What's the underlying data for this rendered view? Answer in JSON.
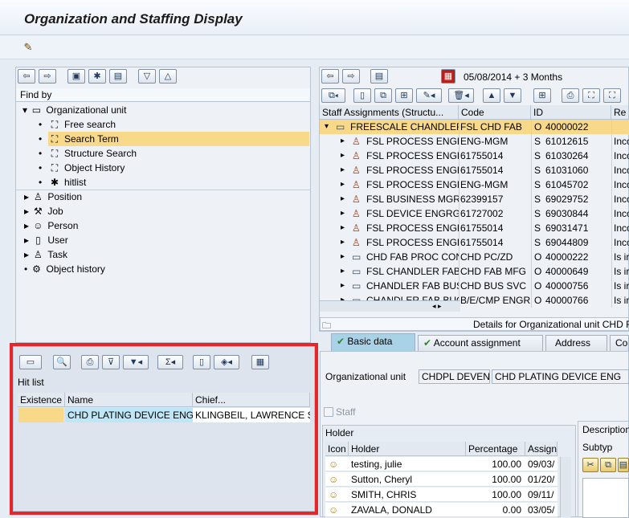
{
  "title": "Organization and Staffing Display",
  "nav": {
    "date": "05/08/2014",
    "period": "+ 3 Months"
  },
  "findby": {
    "header": "Find by",
    "org_unit": "Organizational unit",
    "org_children": [
      "Free search",
      "Search Term",
      "Structure Search",
      "Object History",
      "hitlist"
    ],
    "others": [
      "Position",
      "Job",
      "Person",
      "User",
      "Task",
      "Object history"
    ]
  },
  "hitlist": {
    "title": "Hit list",
    "columns": [
      "Existence",
      "Name",
      "Chief..."
    ],
    "row": {
      "name": "CHD PLATING DEVICE ENG",
      "chief": "KLINGBEIL, LAWRENCE S"
    }
  },
  "staff": {
    "columns": [
      "Staff Assignments (Structu...",
      "Code",
      "ID",
      "Re"
    ],
    "rows": [
      {
        "name": "FREESCALE CHANDLER F",
        "code": "FSL CHD FAB",
        "type": "O",
        "id": "40000022",
        "re": ""
      },
      {
        "name": "FSL PROCESS ENGRG",
        "code": "ENG-MGM",
        "type": "S",
        "id": "61012615",
        "re": "Inco"
      },
      {
        "name": "FSL PROCESS ENGRG",
        "code": "61755014",
        "type": "S",
        "id": "61030264",
        "re": "Inco"
      },
      {
        "name": "FSL PROCESS ENGRG",
        "code": "61755014",
        "type": "S",
        "id": "61031060",
        "re": "Inco"
      },
      {
        "name": "FSL PROCESS ENGRG",
        "code": "ENG-MGM",
        "type": "S",
        "id": "61045702",
        "re": "Inco"
      },
      {
        "name": "FSL BUSINESS MGR I",
        "code": "62399157",
        "type": "S",
        "id": "69029752",
        "re": "Inco"
      },
      {
        "name": "FSL DEVICE ENGRG I",
        "code": "61727002",
        "type": "S",
        "id": "69030844",
        "re": "Inco"
      },
      {
        "name": "FSL PROCESS ENGRG",
        "code": "61755014",
        "type": "S",
        "id": "69031471",
        "re": "Inco"
      },
      {
        "name": "FSL PROCESS ENGRG",
        "code": "61755014",
        "type": "S",
        "id": "69044809",
        "re": "Inco"
      },
      {
        "name": "CHD FAB PROC CONT",
        "code": "CHD PC/ZD",
        "type": "O",
        "id": "40000222",
        "re": "Is ir"
      },
      {
        "name": "FSL CHANDLER FAB",
        "code": "CHD FAB MFG",
        "type": "O",
        "id": "40000649",
        "re": "Is ir"
      },
      {
        "name": "CHANDLER FAB BUSI",
        "code": "CHD BUS SVC",
        "type": "O",
        "id": "40000756",
        "re": "Is ir"
      },
      {
        "name": "CHANDLER FAB BUO",
        "code": "B/E/CMP ENGR",
        "type": "O",
        "id": "40000766",
        "re": "Is ir"
      }
    ]
  },
  "details": {
    "label": "Details for Organizational unit CHD F",
    "tabs": [
      "Basic data",
      "Account assignment",
      "Address",
      "Cost"
    ],
    "org_unit_label": "Organizational unit",
    "org_short": "CHDPL DEVEN...",
    "org_long": "CHD PLATING DEVICE ENG",
    "staff_label": "Staff",
    "holder_section": "Holder",
    "holder_columns": [
      "Icon",
      "Holder",
      "Percentage",
      "Assign"
    ],
    "holders": [
      {
        "name": "testing, julie",
        "pct": "100.00",
        "assign": "09/03/"
      },
      {
        "name": "Sutton, Cheryl",
        "pct": "100.00",
        "assign": "01/20/"
      },
      {
        "name": "SMITH, CHRIS",
        "pct": "100.00",
        "assign": "09/11/"
      },
      {
        "name": "ZAVALA, DONALD",
        "pct": "0.00",
        "assign": "03/05/"
      }
    ],
    "description": "Description",
    "subtype": "Subtyp"
  },
  "colors": {
    "selection": "#f8d98a",
    "hit_name_bg": "#bfe6f6",
    "frame": "#e8262a",
    "active_tab": "#a9d2e6"
  }
}
